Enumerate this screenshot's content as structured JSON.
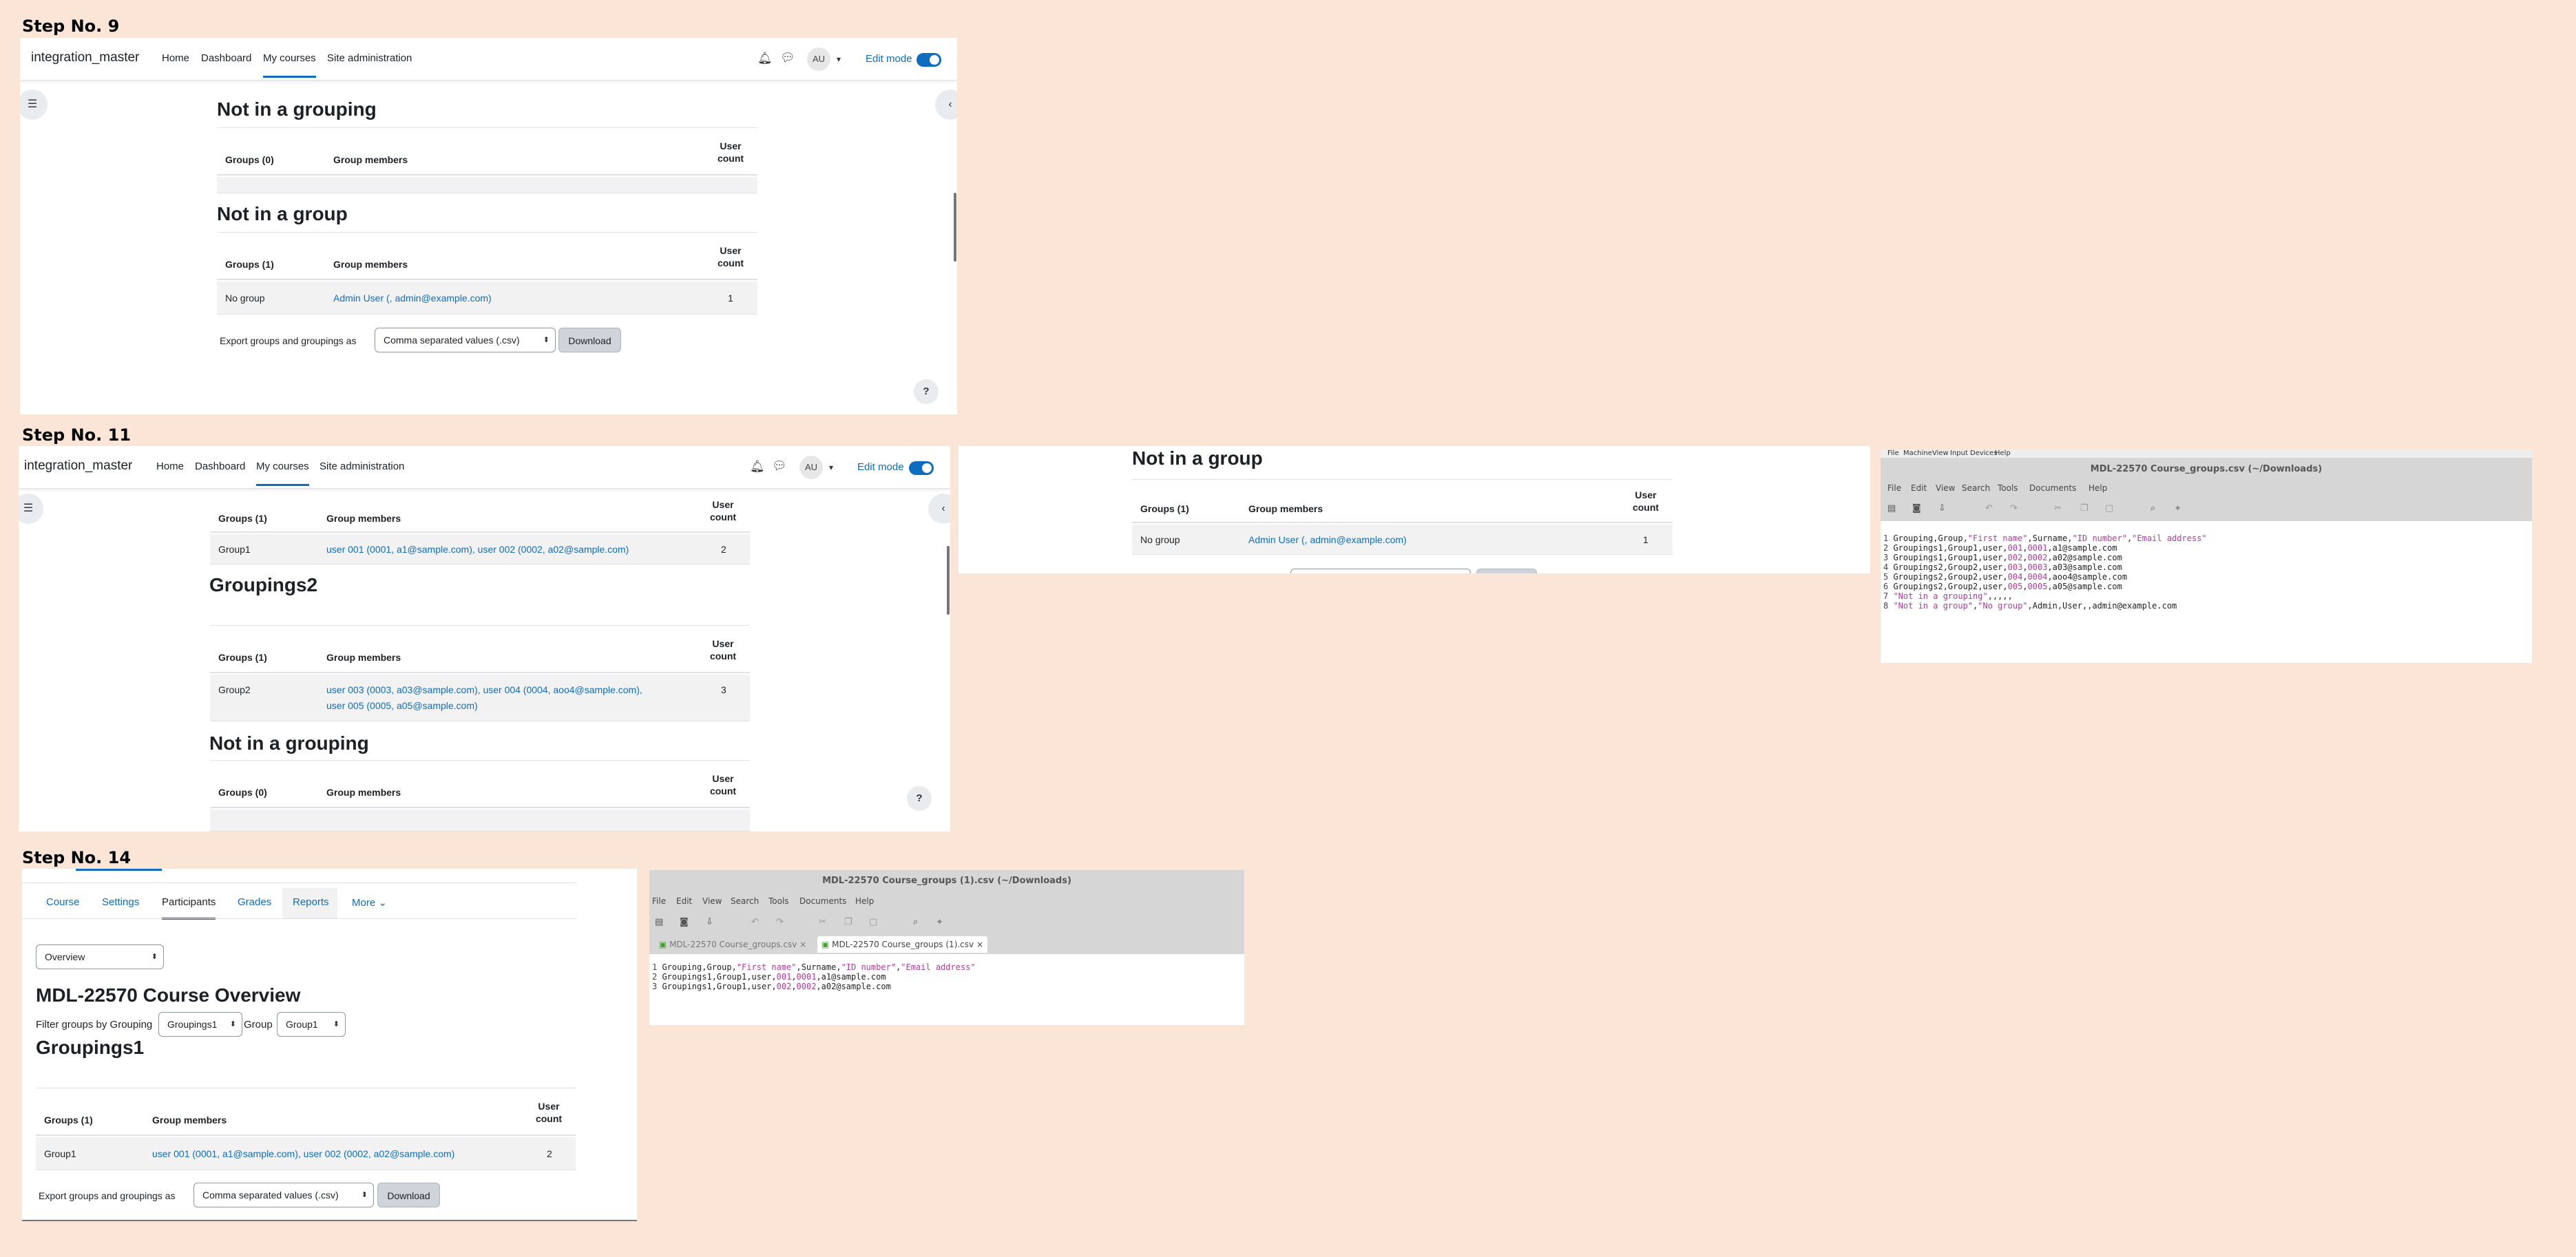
{
  "steps": {
    "s9": "Step No. 9",
    "s11": "Step No. 11",
    "s14": "Step No. 14"
  },
  "moodle": {
    "brand": "integration_master",
    "nav": [
      "Home",
      "Dashboard",
      "My courses",
      "Site administration"
    ],
    "avatar": "AU",
    "edit_mode": "Edit mode",
    "help": "?"
  },
  "table_headers": {
    "groups_0": "Groups (0)",
    "groups_1": "Groups (1)",
    "members": "Group members",
    "user_count_1": "User",
    "user_count_2": "count"
  },
  "step9": {
    "heading_grouping": "Not in a grouping",
    "heading_group": "Not in a group",
    "row_group": "No group",
    "row_members": "Admin User (, admin@example.com)",
    "row_count": "1",
    "export_label": "Export groups and groupings as",
    "export_select": "Comma separated values (.csv)",
    "download": "Download"
  },
  "step11": {
    "g1_group": "Group1",
    "g1_members": "user 001 (0001, a1@sample.com), user 002 (0002, a02@sample.com)",
    "g1_count": "2",
    "heading_groupings2": "Groupings2",
    "g2_group": "Group2",
    "g2_members_line1": "user 003 (0003, a03@sample.com), user 004 (0004, aoo4@sample.com),",
    "g2_members_line2": "user 005 (0005, a05@sample.com)",
    "g2_count": "3",
    "heading_grouping": "Not in a grouping",
    "mid_heading": "Not in a group",
    "mid_group": "No group",
    "mid_members": "Admin User (, admin@example.com)",
    "mid_count": "1"
  },
  "editor1": {
    "vbox_menu": [
      "File",
      "Machine",
      "View",
      "Input",
      "Devices",
      "Help"
    ],
    "title": "MDL-22570 Course_groups.csv (~/Downloads)",
    "menu": [
      "File",
      "Edit",
      "View",
      "Search",
      "Tools",
      "Documents",
      "Help"
    ],
    "lines": [
      "Grouping,Group,\"First name\",Surname,\"ID number\",\"Email address\"",
      "Groupings1,Group1,user,001,0001,a1@sample.com",
      "Groupings1,Group1,user,002,0002,a02@sample.com",
      "Groupings2,Group2,user,003,0003,a03@sample.com",
      "Groupings2,Group2,user,004,0004,aoo4@sample.com",
      "Groupings2,Group2,user,005,0005,a05@sample.com",
      "\"Not in a grouping\",,,,,",
      "\"Not in a group\",\"No group\",Admin,User,,admin@example.com"
    ]
  },
  "step14": {
    "tabs": [
      "Course",
      "Settings",
      "Participants",
      "Grades",
      "Reports",
      "More"
    ],
    "overview_select": "Overview",
    "title": "MDL-22570 Course Overview",
    "filter_label": "Filter groups by Grouping",
    "grouping_select": "Groupings1",
    "group_label": "Group",
    "group_select": "Group1",
    "heading": "Groupings1",
    "row_group": "Group1",
    "row_members": "user 001 (0001, a1@sample.com), user 002 (0002, a02@sample.com)",
    "row_count": "2",
    "export_label": "Export groups and groupings as",
    "export_select": "Comma separated values (.csv)",
    "download": "Download"
  },
  "editor2": {
    "title": "MDL-22570 Course_groups (1).csv (~/Downloads)",
    "menu": [
      "File",
      "Edit",
      "View",
      "Search",
      "Tools",
      "Documents",
      "Help"
    ],
    "tab1": "MDL-22570 Course_groups.csv",
    "tab2": "MDL-22570 Course_groups (1).csv",
    "lines": [
      "Grouping,Group,\"First name\",Surname,\"ID number\",\"Email address\"",
      "Groupings1,Group1,user,001,0001,a1@sample.com",
      "Groupings1,Group1,user,002,0002,a02@sample.com"
    ]
  },
  "colors": {
    "background": "#fbe5d6",
    "link": "#0f6cbf",
    "string": "#b03c9a"
  }
}
